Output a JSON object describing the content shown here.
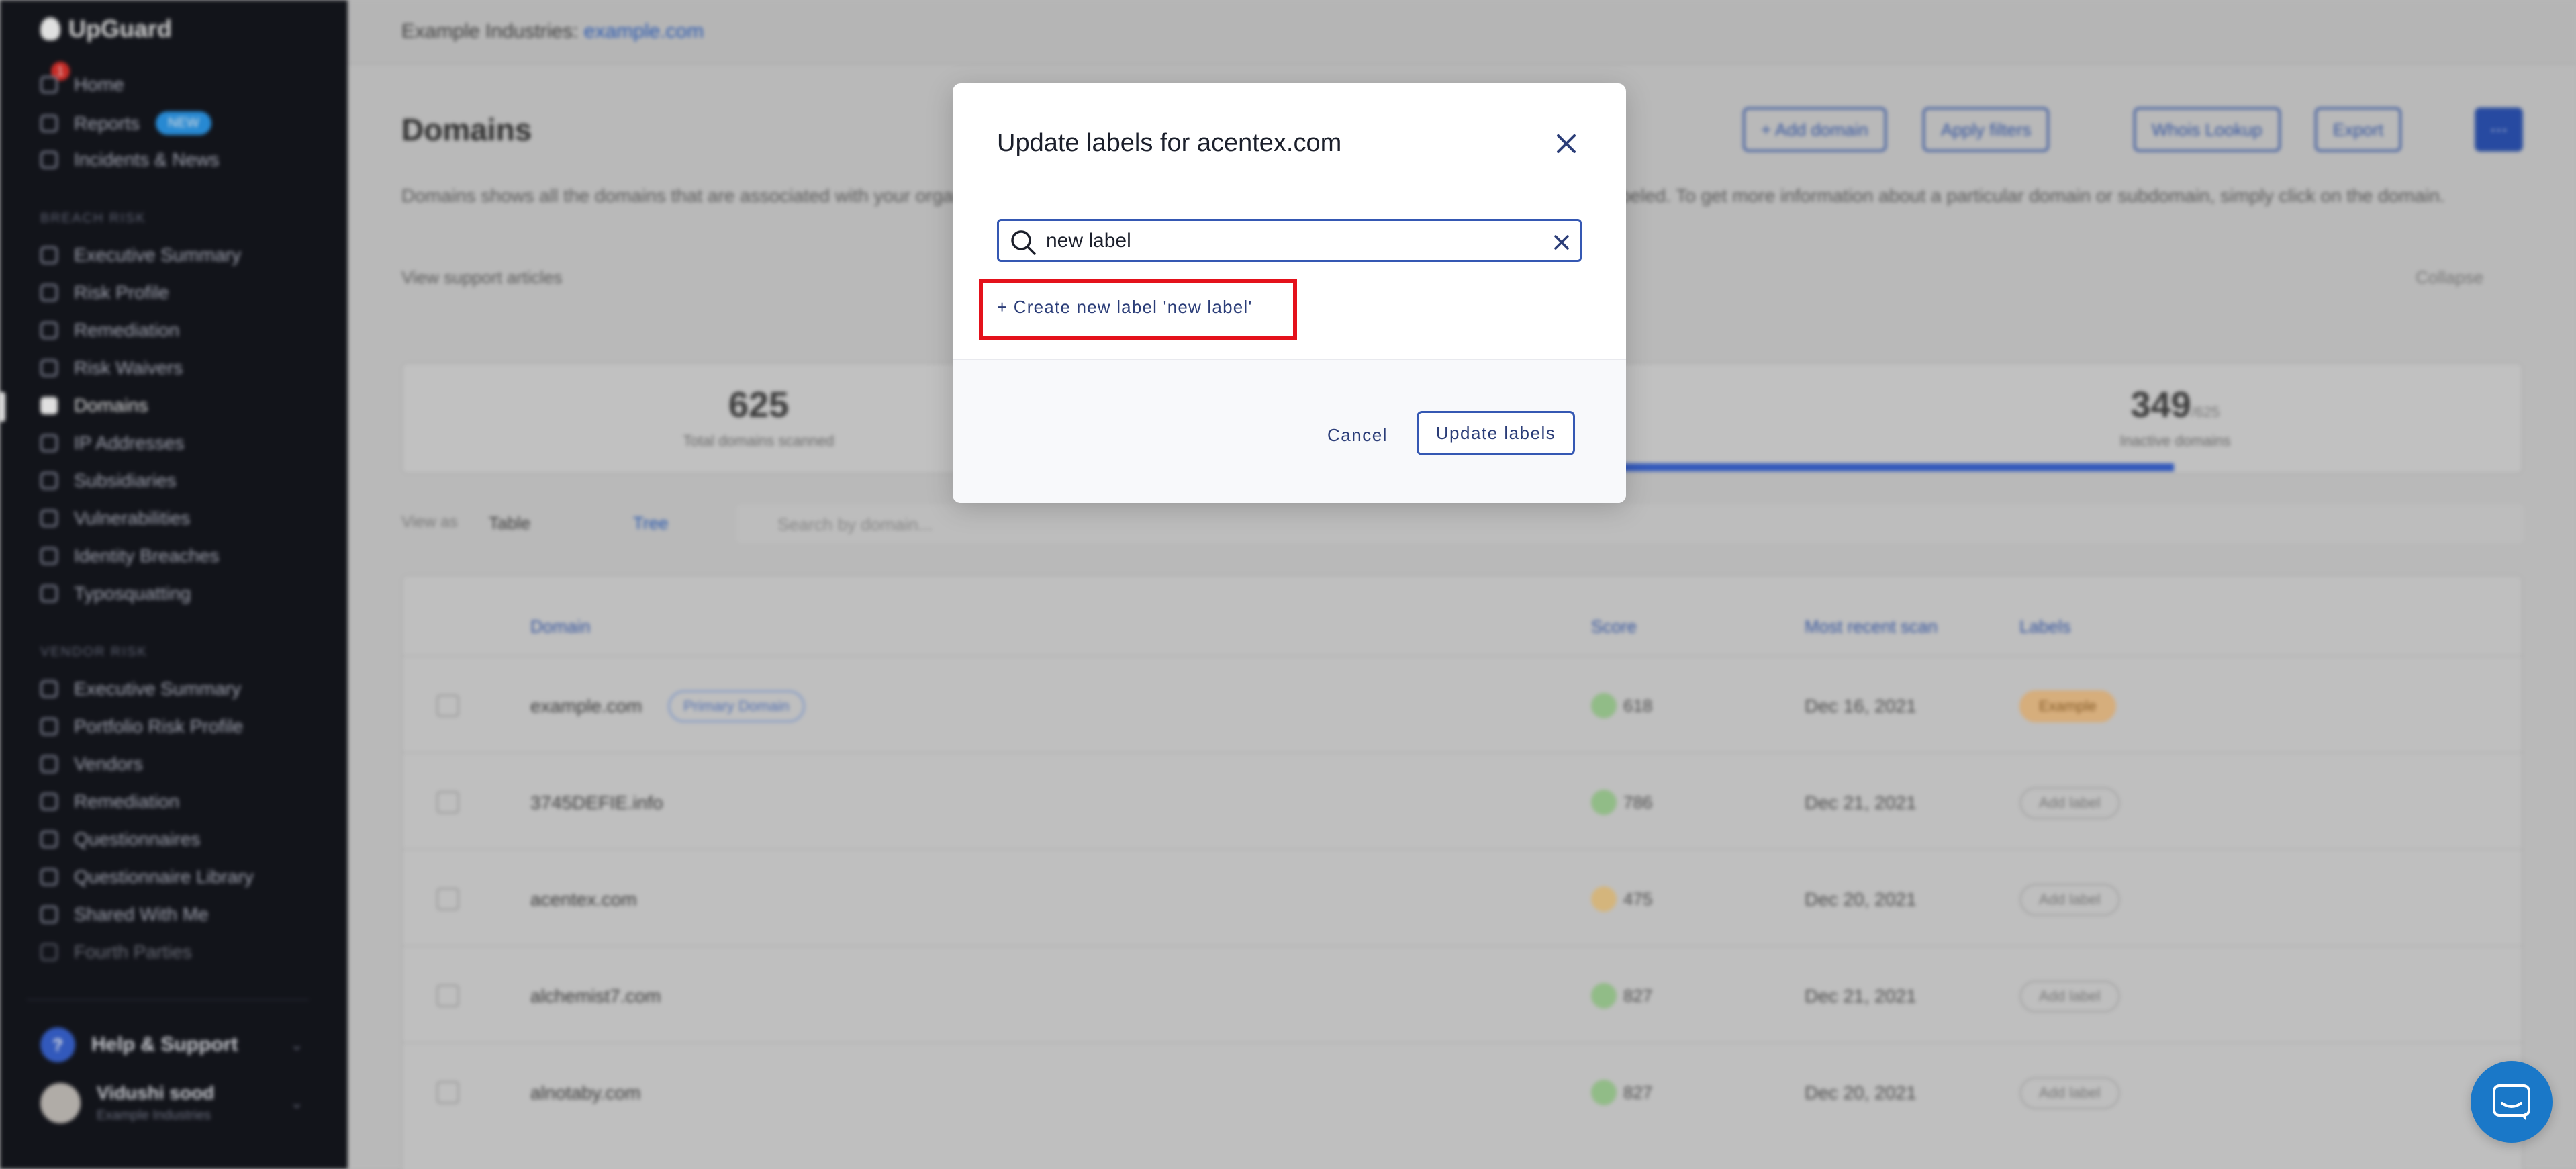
{
  "sidebar": {
    "brand": "UpGuard",
    "notification_count": "1",
    "reports_badge": "NEW",
    "top_items": [
      {
        "label": "Home",
        "icon": "home-icon"
      },
      {
        "label": "Reports",
        "icon": "reports-icon"
      },
      {
        "label": "Incidents & News",
        "icon": "news-icon"
      }
    ],
    "section_risk": "Breach Risk",
    "risk_items": [
      {
        "label": "Executive Summary"
      },
      {
        "label": "Risk Profile"
      },
      {
        "label": "Remediation"
      },
      {
        "label": "Risk Waivers"
      },
      {
        "label": "Domains"
      },
      {
        "label": "IP Addresses"
      },
      {
        "label": "Subsidiaries"
      },
      {
        "label": "Vulnerabilities"
      },
      {
        "label": "Identity Breaches"
      },
      {
        "label": "Typosquatting"
      }
    ],
    "section_vendor": "Vendor Risk",
    "vendor_items": [
      {
        "label": "Executive Summary"
      },
      {
        "label": "Portfolio Risk Profile"
      },
      {
        "label": "Vendors"
      },
      {
        "label": "Remediation"
      },
      {
        "label": "Questionnaires"
      },
      {
        "label": "Questionnaire Library"
      },
      {
        "label": "Shared With Me"
      },
      {
        "label": "Fourth Parties"
      }
    ],
    "help_label": "Help & Support",
    "user_name": "Vidushi sood",
    "user_org": "Example Industries"
  },
  "topbar": {
    "org": "Example Industries",
    "domain_link": "example.com"
  },
  "page": {
    "title": "Domains",
    "buttons": {
      "add_domain": "+ Add domain",
      "apply_filters": "Apply filters",
      "whois": "Whois Lookup",
      "export": "Export"
    },
    "description": "Domains shows all the domains that are associated with your organization. Domains can be sorted by score, most recently scanned, and can be labeled. To get more information about a particular domain or subdomain, simply click on the domain.",
    "support_link": "View support articles",
    "collapse": "Collapse",
    "stats": {
      "total_num": "625",
      "total_label": "Total domains scanned",
      "inactive_num": "349",
      "inactive_unit": "/625",
      "inactive_label": "Inactive domains"
    },
    "view_as": "View as",
    "view_table": "Table",
    "view_tree": "Tree",
    "search_placeholder": "Search by domain...",
    "table": {
      "headers": [
        "Domain",
        "Score",
        "Most recent scan",
        "Labels"
      ],
      "rows": [
        {
          "domain": "example.com",
          "pill": "Primary Domain",
          "score": "618",
          "date": "Dec 16, 2021",
          "label": "Example"
        },
        {
          "domain": "3745DEFIE.info",
          "score": "786",
          "date": "Dec 21, 2021",
          "label": "Add label"
        },
        {
          "domain": "acentex.com",
          "score": "475",
          "date": "Dec 20, 2021",
          "label": "Add label"
        },
        {
          "domain": "alchemist7.com",
          "score": "827",
          "date": "Dec 21, 2021",
          "label": "Add label"
        },
        {
          "domain": "alnotaby.com",
          "score": "827",
          "date": "Dec 20, 2021",
          "label": "Add label"
        }
      ]
    }
  },
  "modal": {
    "title": "Update labels for acentex.com",
    "search_value": "new label",
    "create_label": "+ Create new label 'new label'",
    "cancel": "Cancel",
    "update": "Update labels"
  },
  "colors": {
    "accent": "#3558b3",
    "highlight": "#e4111b",
    "chat": "#1a78c8"
  }
}
